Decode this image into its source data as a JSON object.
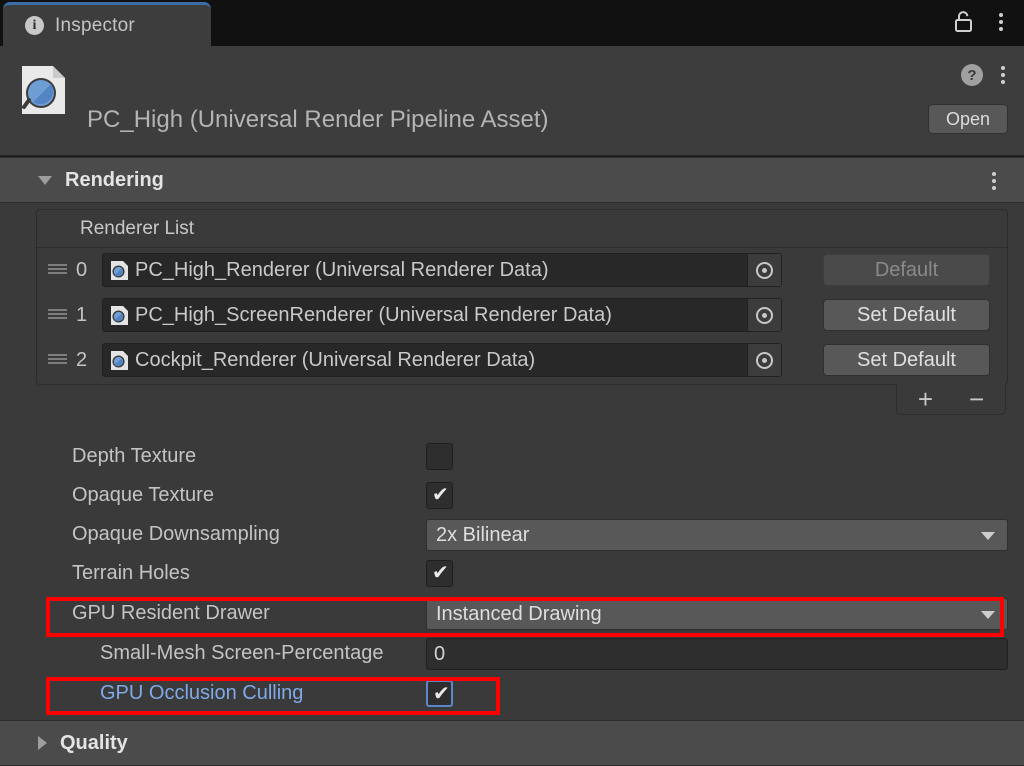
{
  "window": {
    "tab_label": "Inspector",
    "tab_icon": "info-icon",
    "lock_icon": "unlock-icon",
    "menu_icon": "kebab-menu-icon"
  },
  "asset_header": {
    "title": "PC_High (Universal Render Pipeline Asset)",
    "icon": "urp-asset-icon",
    "help_icon": "help-icon",
    "help_glyph": "?",
    "menu_icon": "kebab-menu-icon",
    "open_label": "Open"
  },
  "sections": {
    "rendering": {
      "title": "Rendering",
      "expanded": true,
      "foldout_icon": "triangle-down-icon"
    },
    "quality": {
      "title": "Quality",
      "expanded": false,
      "foldout_icon": "triangle-right-icon"
    }
  },
  "renderer_list": {
    "header": "Renderer List",
    "rows": [
      {
        "index": "0",
        "object": "PC_High_Renderer (Universal Renderer Data)",
        "button_label": "Default",
        "button_enabled": false
      },
      {
        "index": "1",
        "object": "PC_High_ScreenRenderer (Universal Renderer Data)",
        "button_label": "Set Default",
        "button_enabled": true
      },
      {
        "index": "2",
        "object": "Cockpit_Renderer (Universal Renderer Data)",
        "button_label": "Set Default",
        "button_enabled": true
      }
    ],
    "add_label": "+",
    "remove_label": "−"
  },
  "properties": [
    {
      "label": "Depth Texture",
      "type": "checkbox",
      "value": false
    },
    {
      "label": "Opaque Texture",
      "type": "checkbox",
      "value": true
    },
    {
      "label": "Opaque Downsampling",
      "type": "dropdown",
      "value": "2x Bilinear"
    },
    {
      "label": "Terrain Holes",
      "type": "checkbox",
      "value": true
    },
    {
      "label": "GPU Resident Drawer",
      "type": "dropdown",
      "value": "Instanced Drawing"
    },
    {
      "label": "Small-Mesh Screen-Percentage",
      "type": "number",
      "value": "0"
    },
    {
      "label": "GPU Occlusion Culling",
      "type": "checkbox",
      "value": true
    }
  ],
  "check_glyph": "✔",
  "colors": {
    "accent_blue": "#5c87c8",
    "link_blue": "#7fa9e8",
    "highlight_red": "#ff0000",
    "panel_bg": "#3a3a3a",
    "header_bg": "#4b4b4b",
    "field_bg": "#2e2e2e",
    "button_bg": "#585858"
  }
}
